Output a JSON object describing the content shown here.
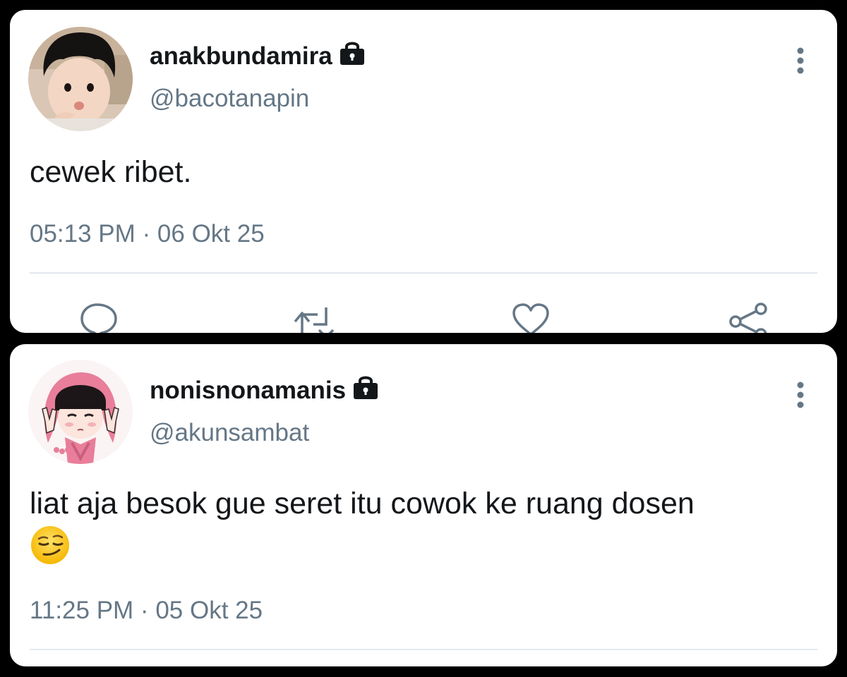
{
  "tweets": [
    {
      "display_name": "anakbundamira",
      "handle": "@bacotanapin",
      "text": "cewek ribet.",
      "timestamp": "05:13 PM · 06 Okt 25",
      "protected_icon": "lock-icon",
      "avatar": "photo of a child blowing a kiss",
      "actions": [
        "reply-icon",
        "retweet-icon",
        "like-icon",
        "share-icon"
      ]
    },
    {
      "display_name": "nonisnonamanis",
      "handle": "@akunsambat",
      "text": "liat aja besok gue seret itu cowok ke ruang dosen",
      "emoji": "smirking-face",
      "timestamp": "11:25 PM · 05 Okt 25",
      "protected_icon": "lock-icon",
      "avatar": "anime girl with pink headscarf"
    }
  ],
  "colors": {
    "background": "#000000",
    "card": "#ffffff",
    "primary_text": "#14171a",
    "secondary_text": "#657786",
    "divider": "#e1e8ed",
    "icon": "#657786"
  }
}
